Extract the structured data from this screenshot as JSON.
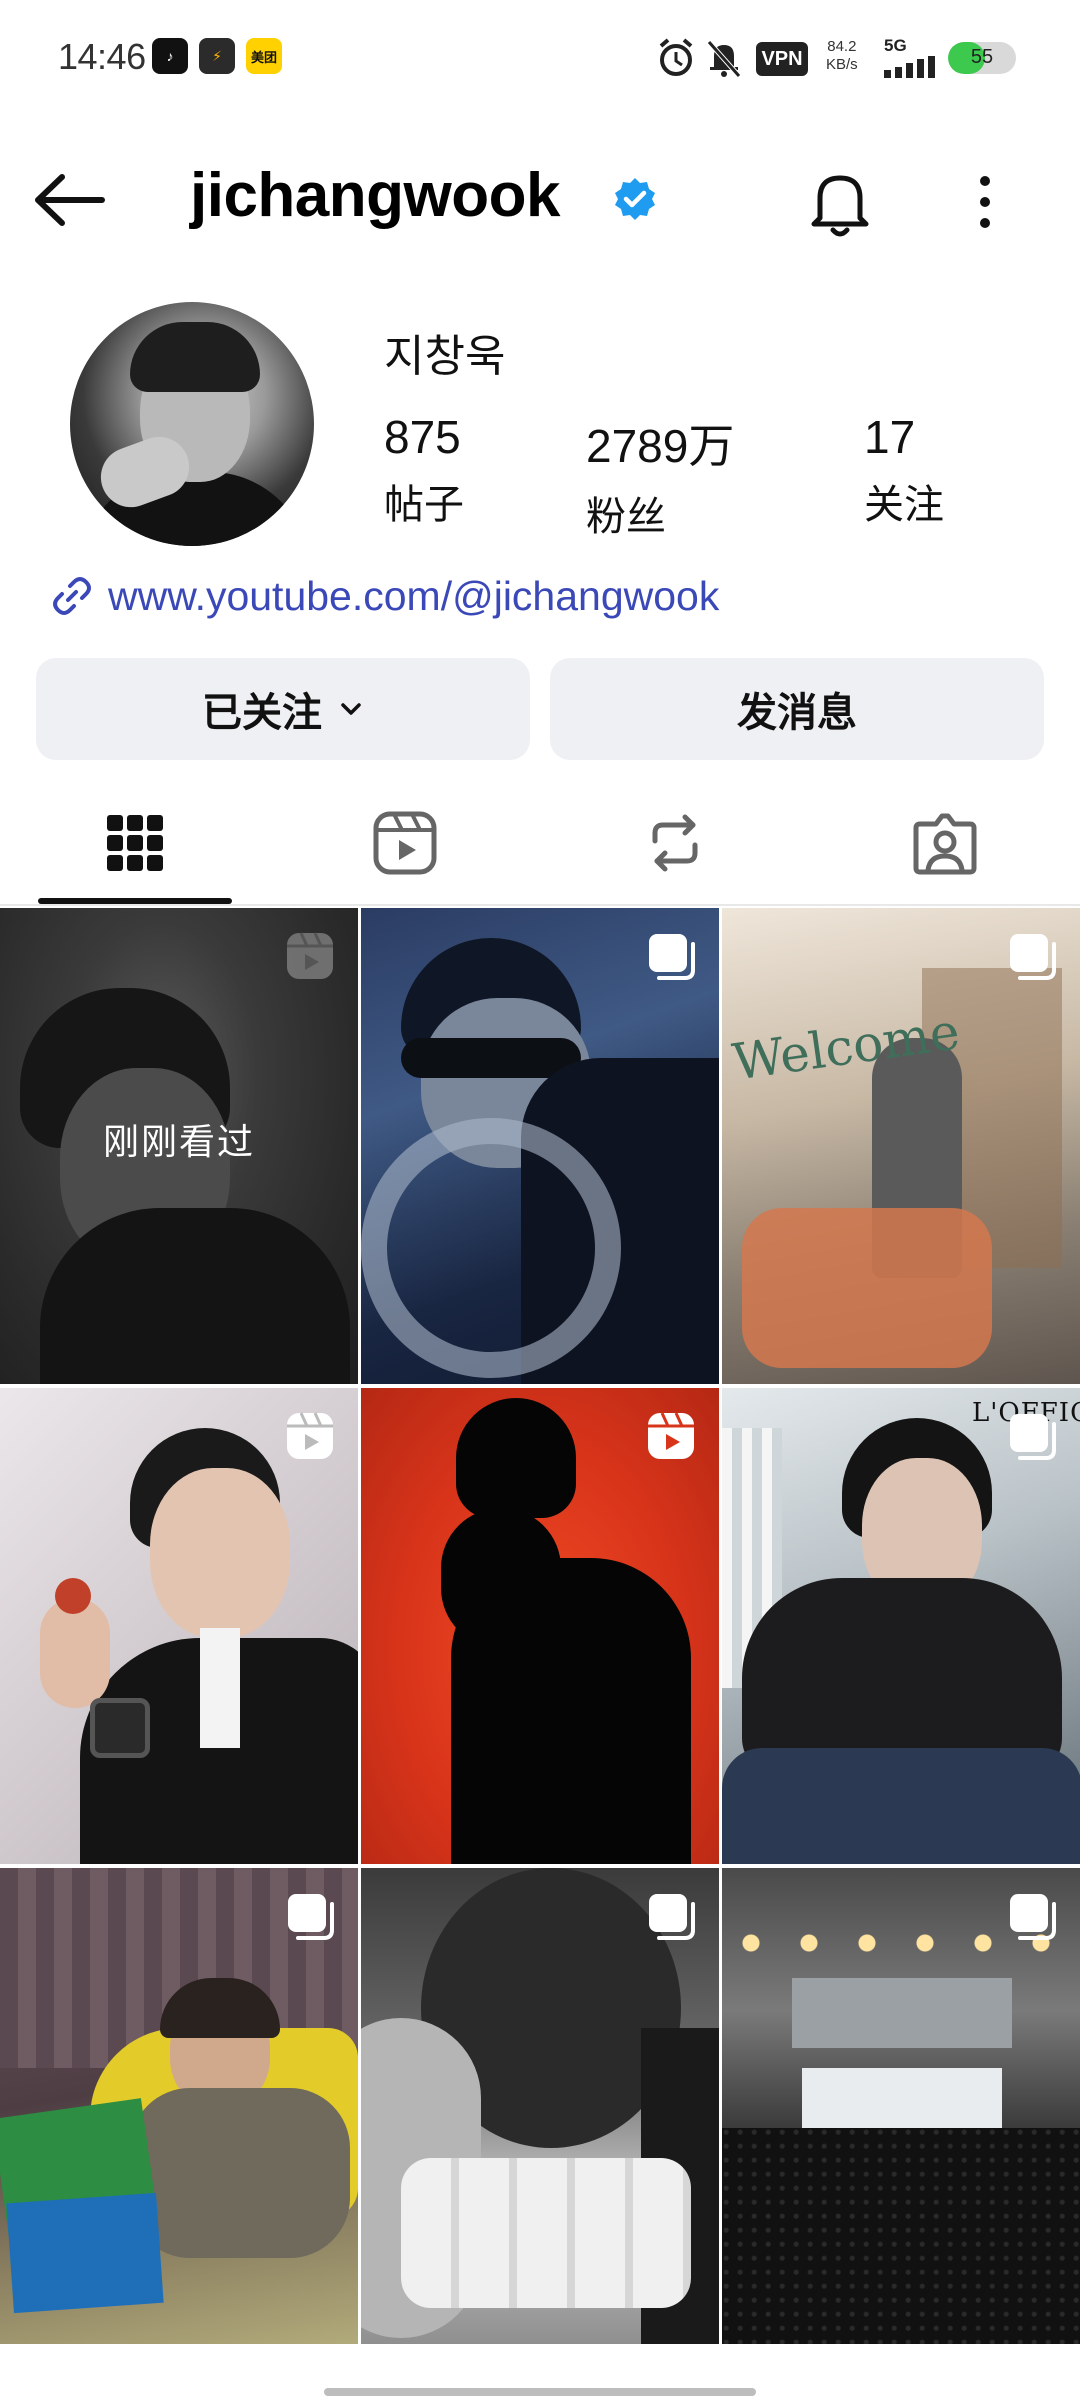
{
  "status_bar": {
    "time": "14:46",
    "apps": [
      "TikTok",
      "Bolt",
      "美团"
    ],
    "vpn": "VPN",
    "speed_value": "84.2",
    "speed_unit": "KB/s",
    "network": "5G",
    "battery": "55",
    "battery_level": 0.55
  },
  "header": {
    "username": "jichangwook",
    "verified": true
  },
  "profile": {
    "display_name": "지창욱",
    "stats": {
      "posts_value": "875",
      "posts_label": "帖子",
      "followers_value": "2789万",
      "followers_label": "粉丝",
      "following_value": "17",
      "following_label": "关注"
    },
    "link": "www.youtube.com/@jichangwook"
  },
  "actions": {
    "following_label": "已关注",
    "message_label": "发消息"
  },
  "tabs": [
    "grid-icon",
    "reels-icon",
    "reposts-icon",
    "tagged-icon"
  ],
  "grid": {
    "seen_label": "刚刚看过",
    "tiles": [
      {
        "type": "reel"
      },
      {
        "type": "multi"
      },
      {
        "type": "multi"
      },
      {
        "type": "reel"
      },
      {
        "type": "reel"
      },
      {
        "type": "multi"
      },
      {
        "type": "multi"
      },
      {
        "type": "multi"
      },
      {
        "type": "multi"
      }
    ]
  },
  "colors": {
    "link": "#3b48b8",
    "verified": "#1f9bf0",
    "button_bg": "#eef0f3"
  }
}
